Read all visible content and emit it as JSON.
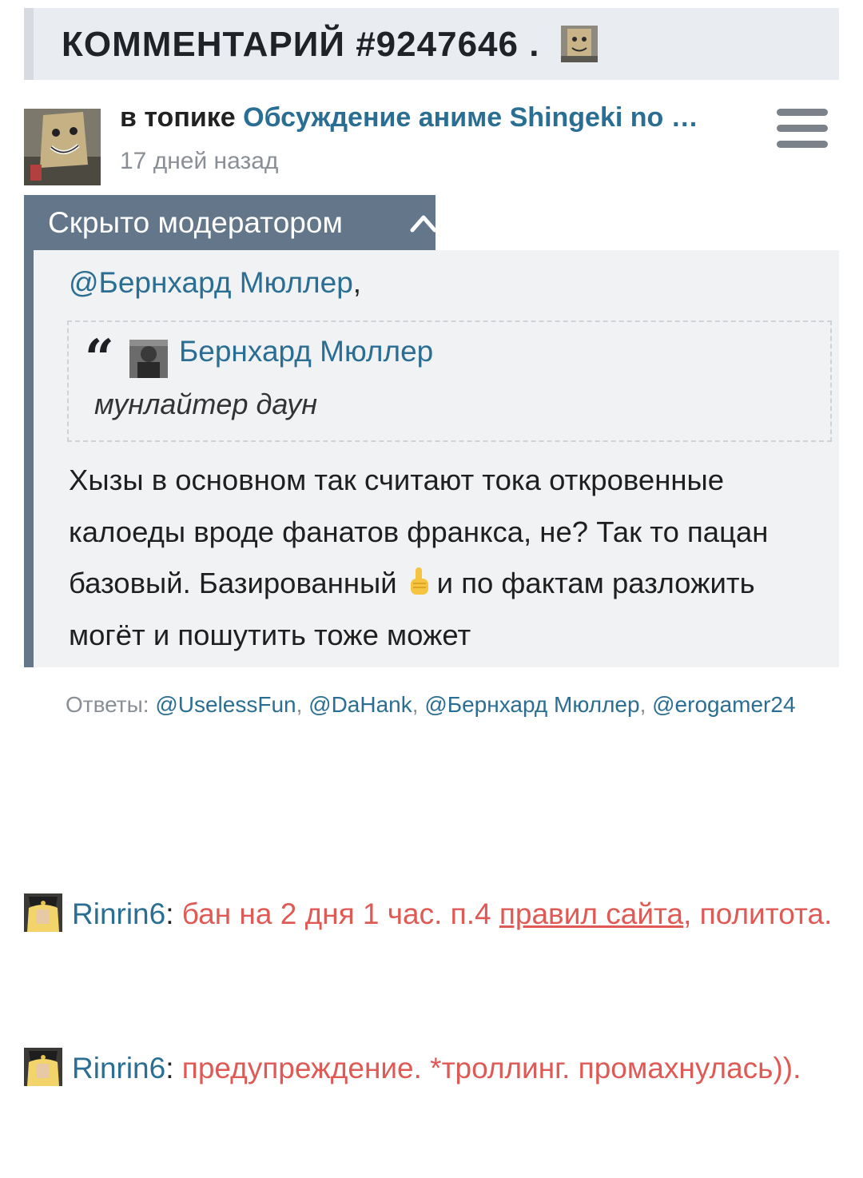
{
  "header": {
    "title": "КОММЕНТАРИЙ #9247646 .",
    "avatar_icon": "paper-bag-avatar-icon"
  },
  "meta": {
    "prefix": "в топике",
    "topic_link": "Обсуждение аниме Shingeki no …",
    "time": "17 дней назад",
    "menu_icon": "hamburger-menu-icon"
  },
  "moderation": {
    "status_label": "Скрыто модератором",
    "toggle_icon": "chevron-up-icon"
  },
  "comment": {
    "mention": "@Бернхард Мюллер",
    "mention_suffix": ",",
    "quote": {
      "mark": "“",
      "author": "Бернхард Мюллер",
      "text": "мунлайтер даун"
    },
    "body_part1": "Хызы в основном так считают тока откровенные калоеды вроде фанатов франкса, не? Так то пацан базовый. Базированный",
    "emoji": "☝",
    "body_part2": "и по фактам разложить могёт и пошутить тоже может"
  },
  "replies": {
    "label": "Ответы:",
    "users": [
      "@UselessFun",
      "@DaHank",
      "@Бернхард Мюллер",
      "@erogamer24"
    ]
  },
  "mod_actions": [
    {
      "moderator": "Rinrin6",
      "separator": ":",
      "text_before_link": "бан на 2 дня 1 час. п.4",
      "link": "правил сайта",
      "text_after_link": ", политота."
    },
    {
      "moderator": "Rinrin6",
      "separator": ":",
      "text": "предупреждение. *троллинг. промахнулась))."
    }
  ],
  "colors": {
    "link": "#2a6e93",
    "moderation_bar": "#64778a",
    "moderation_text": "#e05a55",
    "header_bg": "#e9ecf0",
    "comment_bg": "#f1f2f4"
  }
}
